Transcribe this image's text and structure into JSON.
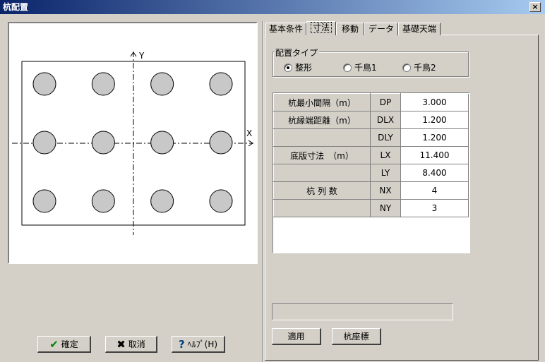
{
  "window": {
    "title": "杭配置",
    "close_label": "×"
  },
  "tabs": [
    {
      "label": "基本条件"
    },
    {
      "label": "寸法"
    },
    {
      "label": "移動"
    },
    {
      "label": "データ"
    },
    {
      "label": "基礎天端"
    }
  ],
  "layout_type": {
    "title": "配置タイプ",
    "options": [
      {
        "label": "整形",
        "selected": true
      },
      {
        "label": "千鳥1",
        "selected": false
      },
      {
        "label": "千鳥2",
        "selected": false
      }
    ]
  },
  "table": {
    "rows": [
      {
        "label": "杭最小間隔（m）",
        "code": "DP",
        "value": "3.000"
      },
      {
        "label": "杭縁端距離（m）",
        "code": "DLX",
        "value": "1.200"
      },
      {
        "label": "",
        "code": "DLY",
        "value": "1.200"
      },
      {
        "label": "底版寸法　（m）",
        "code": "LX",
        "value": "11.400"
      },
      {
        "label": "",
        "code": "LY",
        "value": "8.400"
      },
      {
        "label": "杭 列 数",
        "code": "NX",
        "value": "4"
      },
      {
        "label": "",
        "code": "NY",
        "value": "3"
      }
    ]
  },
  "preview": {
    "axis_x": "X",
    "axis_y": "Y",
    "columns": 4,
    "rows": 3
  },
  "buttons": {
    "apply": "適用",
    "pile_coords": "杭座標",
    "ok": "確定",
    "cancel": "取消",
    "help": "ﾍﾙﾌﾟ(H)"
  },
  "icons": {
    "ok": "check-icon",
    "cancel": "cross-icon",
    "help": "question-icon"
  },
  "colors": {
    "titlebar": "#0a246a",
    "face": "#d4d0c8",
    "pile_fill": "#c8c8c8",
    "ok_check": "#008000"
  }
}
